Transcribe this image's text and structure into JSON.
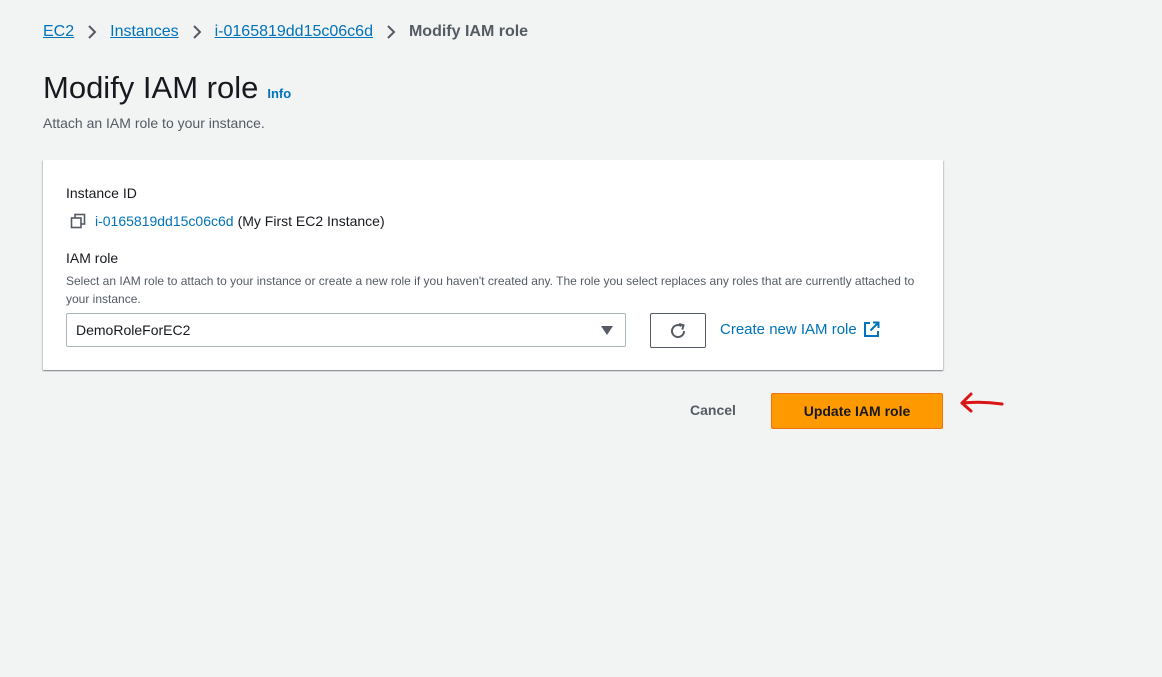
{
  "breadcrumb": {
    "items": [
      {
        "label": "EC2"
      },
      {
        "label": "Instances"
      },
      {
        "label": "i-0165819dd15c06c6d"
      }
    ],
    "current": "Modify IAM role",
    "separator_icon": "chevron-right-icon"
  },
  "header": {
    "title": "Modify IAM role",
    "info_label": "Info",
    "subtitle": "Attach an IAM role to your instance."
  },
  "form": {
    "instance_id": {
      "label": "Instance ID",
      "copy_icon": "copy-icon",
      "id_value": "i-0165819dd15c06c6d",
      "name_value": "(My First EC2 Instance)"
    },
    "iam_role": {
      "label": "IAM role",
      "description": "Select an IAM role to attach to your instance or create a new role if you haven't created any. The role you select replaces any roles that are currently attached to your instance.",
      "selected_value": "DemoRoleForEC2",
      "refresh_icon": "refresh-icon",
      "create_link_label": "Create new IAM role",
      "external_icon": "external-link-icon"
    }
  },
  "actions": {
    "cancel_label": "Cancel",
    "submit_label": "Update IAM role"
  },
  "annotation": {
    "arrow_icon": "arrow-left-icon",
    "arrow_color": "#d91515"
  },
  "colors": {
    "link": "#0073bb",
    "primary_button": "#ff9900",
    "background": "#f2f3f3"
  }
}
